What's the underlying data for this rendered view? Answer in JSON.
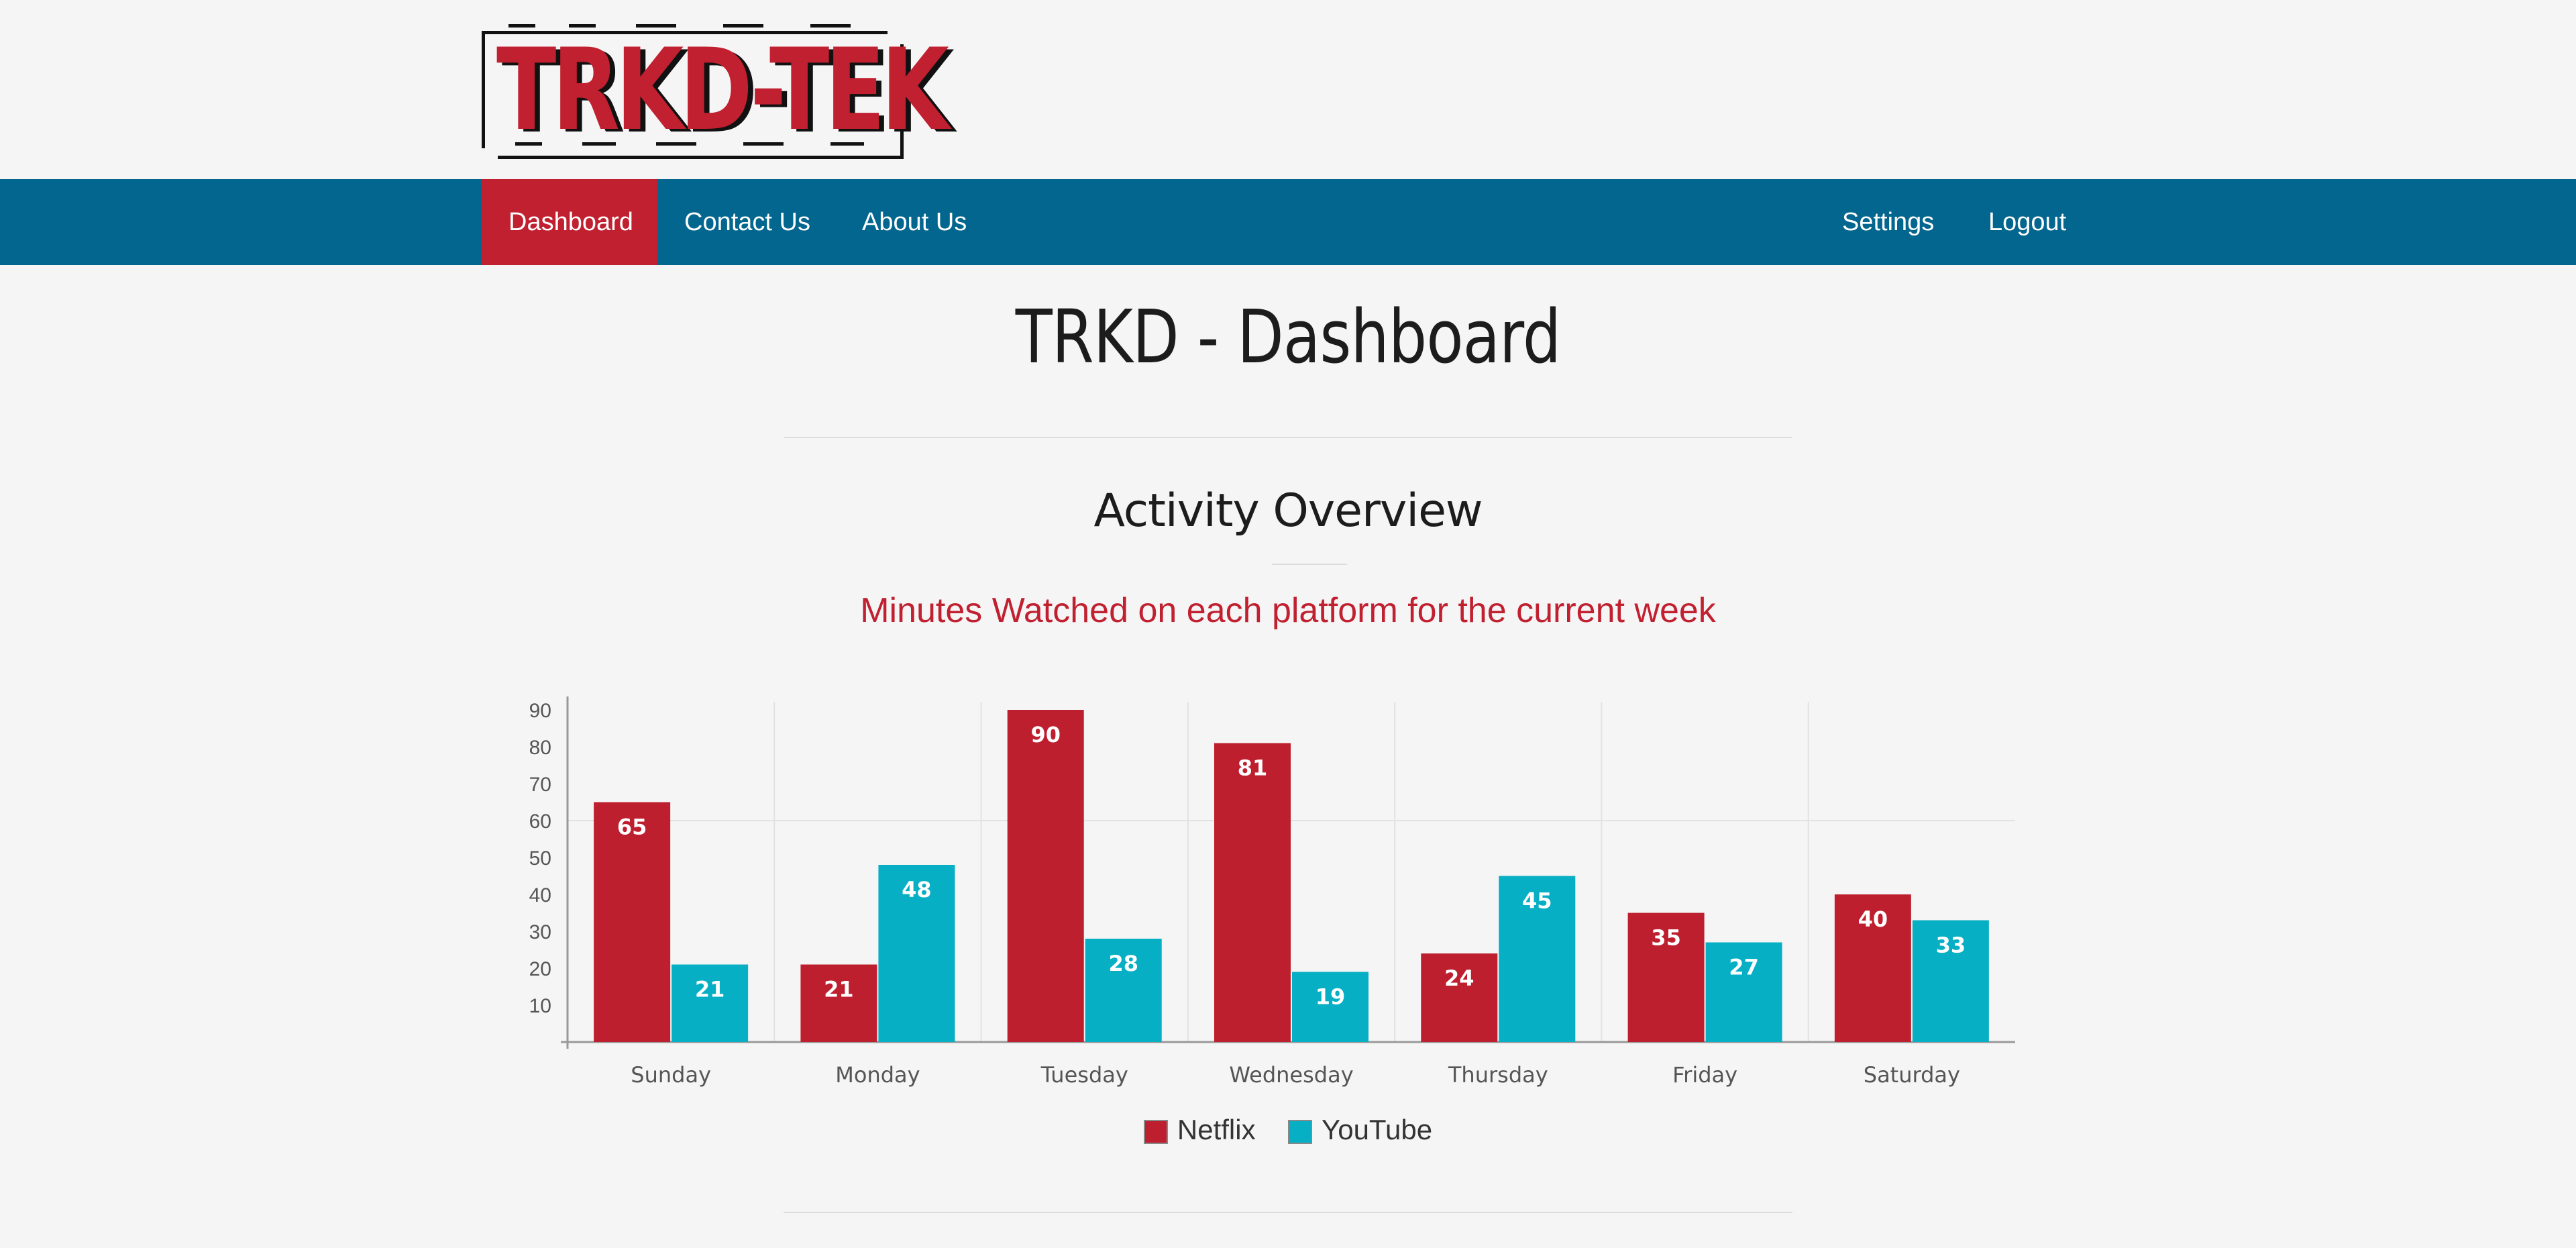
{
  "logo": {
    "text": "TRKD-TEK"
  },
  "nav": {
    "left": [
      {
        "label": "Dashboard",
        "active": true
      },
      {
        "label": "Contact Us",
        "active": false
      },
      {
        "label": "About Us",
        "active": false
      }
    ],
    "right": [
      {
        "label": "Settings"
      },
      {
        "label": "Logout"
      }
    ]
  },
  "page": {
    "title": "TRKD - Dashboard",
    "section_title": "Activity Overview",
    "subtitle": "Minutes Watched on each platform for the current week"
  },
  "colors": {
    "nav_bg": "#03668e",
    "accent": "#c0202f",
    "netflix": "#be1f2e",
    "youtube": "#07afc4"
  },
  "chart_data": {
    "type": "bar",
    "categories": [
      "Sunday",
      "Monday",
      "Tuesday",
      "Wednesday",
      "Thursday",
      "Friday",
      "Saturday"
    ],
    "series": [
      {
        "name": "Netflix",
        "color": "#be1f2e",
        "values": [
          65,
          21,
          90,
          81,
          24,
          35,
          40
        ]
      },
      {
        "name": "YouTube",
        "color": "#07afc4",
        "values": [
          21,
          48,
          28,
          19,
          45,
          27,
          33
        ]
      }
    ],
    "yticks": [
      10,
      20,
      30,
      40,
      50,
      60,
      70,
      80,
      90
    ],
    "ylim": [
      0,
      90
    ],
    "title": "",
    "xlabel": "",
    "ylabel": "",
    "legend": "bottom-center",
    "grid": true,
    "data_labels": true
  }
}
